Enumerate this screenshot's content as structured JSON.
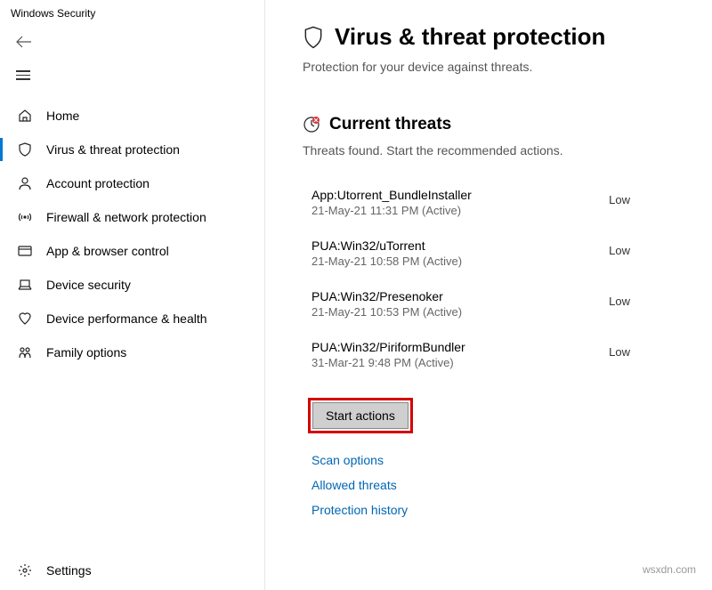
{
  "appTitle": "Windows Security",
  "sidebar": {
    "items": [
      {
        "label": "Home"
      },
      {
        "label": "Virus & threat protection"
      },
      {
        "label": "Account protection"
      },
      {
        "label": "Firewall & network protection"
      },
      {
        "label": "App & browser control"
      },
      {
        "label": "Device security"
      },
      {
        "label": "Device performance & health"
      },
      {
        "label": "Family options"
      }
    ],
    "settings": "Settings"
  },
  "main": {
    "title": "Virus & threat protection",
    "subtitle": "Protection for your device against threats.",
    "currentThreats": {
      "heading": "Current threats",
      "sub": "Threats found. Start the recommended actions.",
      "items": [
        {
          "name": "App:Utorrent_BundleInstaller",
          "meta": "21-May-21 11:31 PM (Active)",
          "severity": "Low"
        },
        {
          "name": "PUA:Win32/uTorrent",
          "meta": "21-May-21 10:58 PM (Active)",
          "severity": "Low"
        },
        {
          "name": "PUA:Win32/Presenoker",
          "meta": "21-May-21 10:53 PM (Active)",
          "severity": "Low"
        },
        {
          "name": "PUA:Win32/PiriformBundler",
          "meta": "31-Mar-21 9:48 PM (Active)",
          "severity": "Low"
        }
      ],
      "startActions": "Start actions",
      "links": {
        "scanOptions": "Scan options",
        "allowedThreats": "Allowed threats",
        "protectionHistory": "Protection history"
      }
    }
  },
  "watermark": "wsxdn.com"
}
